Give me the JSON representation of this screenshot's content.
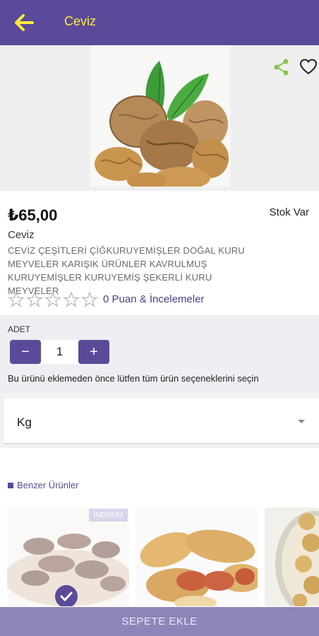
{
  "header": {
    "title": "Ceviz",
    "back_icon": "arrow-left-icon",
    "accent_color": "#ffeb3b",
    "background": "#5a4a99"
  },
  "product": {
    "price": "₺65,00",
    "stock": "Stok Var",
    "name": "Ceviz",
    "description": "CEVİZ ÇEŞİTLERİ ÇİĞKURUYEMİŞLER DOĞAL KURU MEYVELER KARIŞIK ÜRÜNLER KAVRULMUŞ KURUYEMİŞLER KURUYEMİŞ ŞEKERLİ KURU MEYVELER",
    "rating": 0,
    "reviews_link": "0 Puan & İncelemeler",
    "image_indicator_count": 1
  },
  "quantity": {
    "label": "ADET",
    "value": "1",
    "minus": "−",
    "plus": "+",
    "hint": "Bu ürünü eklemeden önce lütfen tüm ürün seçeneklerini seçin"
  },
  "option": {
    "selected": "Kg"
  },
  "similar": {
    "title": "Benzer Ürünler",
    "badge": "İNDİRİM",
    "items": [
      {
        "image": "dates-icon"
      },
      {
        "image": "peanuts-icon"
      },
      {
        "image": "chickpeas-icon"
      }
    ]
  },
  "cart": {
    "label": "SEPETE EKLE"
  }
}
